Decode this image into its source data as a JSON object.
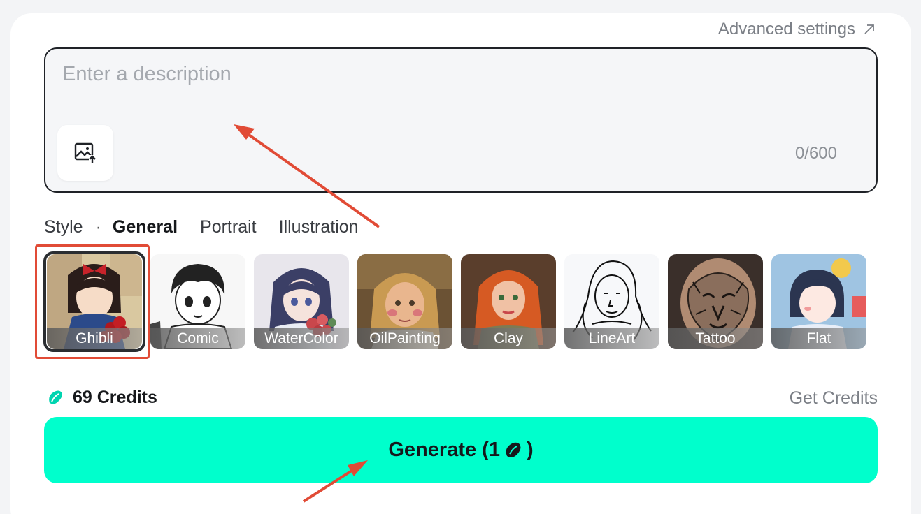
{
  "header": {
    "advanced_settings": "Advanced settings"
  },
  "description": {
    "placeholder": "Enter a description",
    "value": "",
    "counter": "0/600"
  },
  "style": {
    "label": "Style",
    "separator": "·",
    "tabs": [
      {
        "label": "General",
        "active": true
      },
      {
        "label": "Portrait",
        "active": false
      },
      {
        "label": "Illustration",
        "active": false
      }
    ],
    "items": [
      {
        "label": "Ghibli",
        "selected": true
      },
      {
        "label": "Comic",
        "selected": false
      },
      {
        "label": "WaterColor",
        "selected": false
      },
      {
        "label": "OilPainting",
        "selected": false
      },
      {
        "label": "Clay",
        "selected": false
      },
      {
        "label": "LineArt",
        "selected": false
      },
      {
        "label": "Tattoo",
        "selected": false
      },
      {
        "label": "Flat",
        "selected": false
      }
    ]
  },
  "credits": {
    "label": "69 Credits",
    "get_label": "Get Credits",
    "icon": "bean-icon",
    "color": "#00d4b0"
  },
  "generate": {
    "label_prefix": "Generate (1",
    "label_suffix": ")",
    "color": "#00ffcc"
  },
  "annotations": {
    "highlight_color": "#e14b36"
  }
}
